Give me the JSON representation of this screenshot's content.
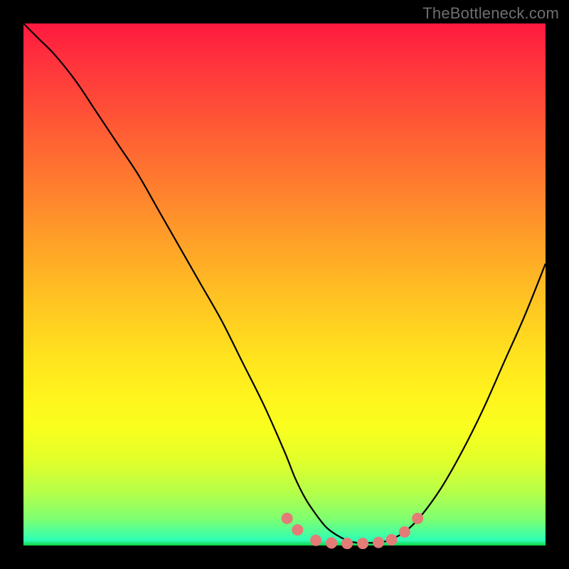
{
  "watermark": "TheBottleneck.com",
  "colors": {
    "frame": "#000000",
    "curve": "#000000",
    "marker": "#e37b77",
    "marker_stroke": "#4a2c2a"
  },
  "chart_data": {
    "type": "line",
    "title": "",
    "xlabel": "",
    "ylabel": "",
    "xlim": [
      0,
      100
    ],
    "ylim": [
      0,
      100
    ],
    "series": [
      {
        "name": "bottleneck-curve",
        "x": [
          0,
          3,
          6,
          10,
          14,
          18,
          22,
          26,
          30,
          34,
          38,
          42,
          46,
          50,
          52,
          54,
          56,
          58,
          60,
          62,
          64,
          66,
          68,
          70,
          73,
          76,
          80,
          84,
          88,
          92,
          96,
          100
        ],
        "y": [
          100,
          97,
          94,
          89,
          83,
          77,
          71,
          64,
          57,
          50,
          43,
          35,
          27,
          18,
          13,
          9,
          6,
          3.5,
          2,
          1,
          0.5,
          0.5,
          0.6,
          1,
          2.6,
          5.5,
          11,
          18,
          26,
          35,
          44,
          54
        ]
      }
    ],
    "markers": {
      "name": "flat-region-dots",
      "x": [
        50.5,
        52.5,
        56,
        59,
        62,
        65,
        68,
        70.5,
        73,
        75.5
      ],
      "y": [
        5.2,
        3.0,
        1.0,
        0.5,
        0.4,
        0.4,
        0.6,
        1.1,
        2.6,
        5.2
      ]
    }
  }
}
